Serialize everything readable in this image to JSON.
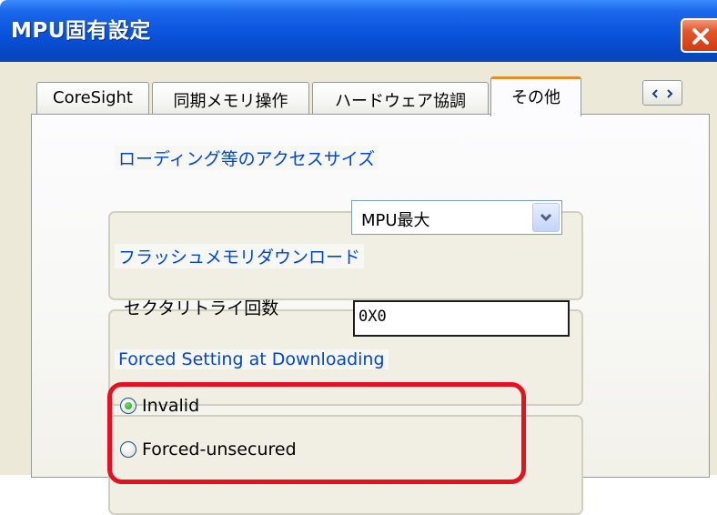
{
  "window": {
    "title": "MPU固有設定"
  },
  "tabs": [
    {
      "label": "CoreSight",
      "active": false
    },
    {
      "label": "同期メモリ操作",
      "active": false
    },
    {
      "label": "ハードウェア協調",
      "active": false
    },
    {
      "label": "その他",
      "active": true
    }
  ],
  "access_size": {
    "group_title": "ローディング等のアクセスサイズ",
    "selected": "MPU最大"
  },
  "flash": {
    "group_title": "フラッシュメモリダウンロード",
    "retry_label": "セクタリトライ回数",
    "retry_value": "0X0"
  },
  "forced": {
    "group_title": "Forced Setting at Downloading",
    "options": [
      {
        "label": "Invalid",
        "selected": true
      },
      {
        "label": "Forced-unsecured",
        "selected": false
      }
    ]
  },
  "colors": {
    "titlebar": "#0a53dc",
    "group_title": "#0046d5",
    "highlight": "#e8101e"
  }
}
